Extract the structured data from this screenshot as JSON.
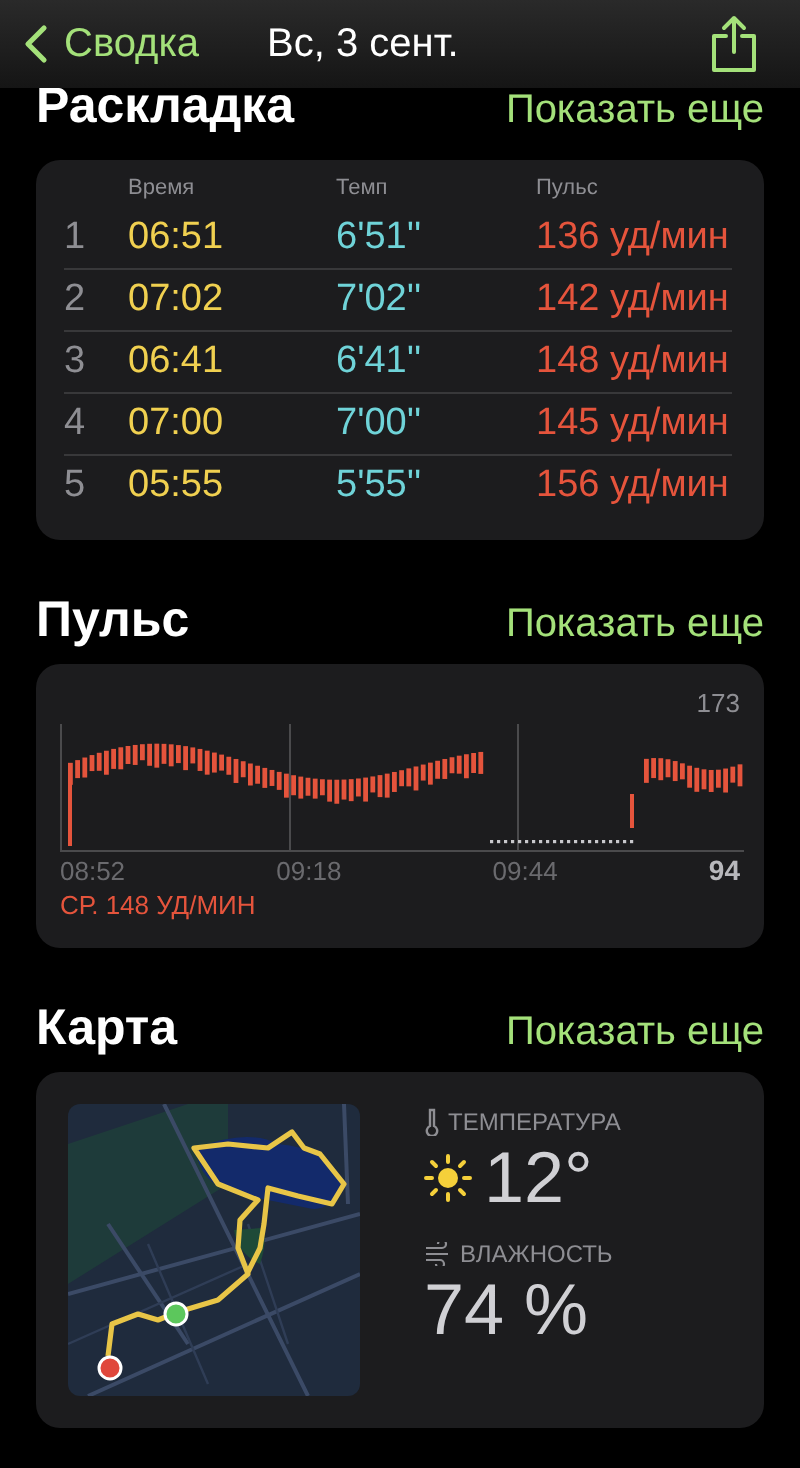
{
  "header": {
    "back_label": "Сводка",
    "title": "Вс, 3 сент."
  },
  "splits": {
    "title": "Раскладка",
    "more_link": "Показать еще",
    "columns": [
      "Время",
      "Темп",
      "Пульс"
    ],
    "rows": [
      {
        "index": "1",
        "time": "06:51",
        "pace": "6'51''",
        "pulse": "136 уд/мин"
      },
      {
        "index": "2",
        "time": "07:02",
        "pace": "7'02''",
        "pulse": "142 уд/мин"
      },
      {
        "index": "3",
        "time": "06:41",
        "pace": "6'41''",
        "pulse": "148 уд/мин"
      },
      {
        "index": "4",
        "time": "07:00",
        "pace": "7'00''",
        "pulse": "145 уд/мин"
      },
      {
        "index": "5",
        "time": "05:55",
        "pace": "5'55''",
        "pulse": "156 уд/мин"
      }
    ]
  },
  "heart_rate": {
    "title": "Пульс",
    "more_link": "Показать еще",
    "max_label": "173",
    "min_label": "94",
    "time_labels": [
      "08:52",
      "09:18",
      "09:44"
    ],
    "average": "СР. 148 УД/МИН"
  },
  "map": {
    "title": "Карта",
    "more_link": "Показать еще",
    "temperature_label": "ТЕМПЕРАТУРА",
    "temperature": "12°",
    "humidity_label": "ВЛАЖНОСТЬ",
    "humidity": "74 %"
  }
}
